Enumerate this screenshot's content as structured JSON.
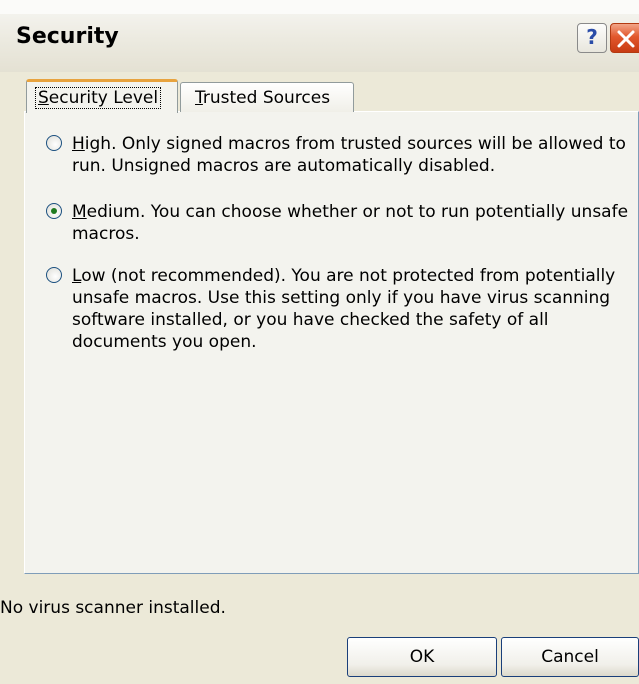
{
  "window": {
    "title": "Security",
    "help_glyph": "?"
  },
  "tabs": [
    {
      "label": "Security Level",
      "hotkey": "S",
      "rest": "ecurity Level",
      "active": true
    },
    {
      "label": "Trusted Sources",
      "hotkey": "T",
      "rest": "rusted Sources",
      "active": false
    }
  ],
  "options": {
    "high": {
      "hotkey": "H",
      "rest": "igh. Only signed macros from trusted sources will be allowed to run. Unsigned macros are automatically disabled.",
      "checked": false
    },
    "medium": {
      "hotkey": "M",
      "rest": "edium. You can choose whether or not to run potentially unsafe macros.",
      "checked": true
    },
    "low": {
      "hotkey": "L",
      "rest": "ow (not recommended). You are not protected from potentially unsafe macros. Use this setting only if you have virus scanning software installed, or you have checked the safety of all documents you open.",
      "checked": false
    }
  },
  "status": "No virus scanner installed.",
  "buttons": {
    "ok": "OK",
    "cancel": "Cancel"
  },
  "colors": {
    "dialog_bg": "#ece9d8",
    "active_tab_accent": "#e8a33e",
    "close_button": "#e2582d",
    "radio_dot": "#1f7a1f"
  },
  "icons": {
    "help": "help-icon",
    "close": "close-icon"
  }
}
